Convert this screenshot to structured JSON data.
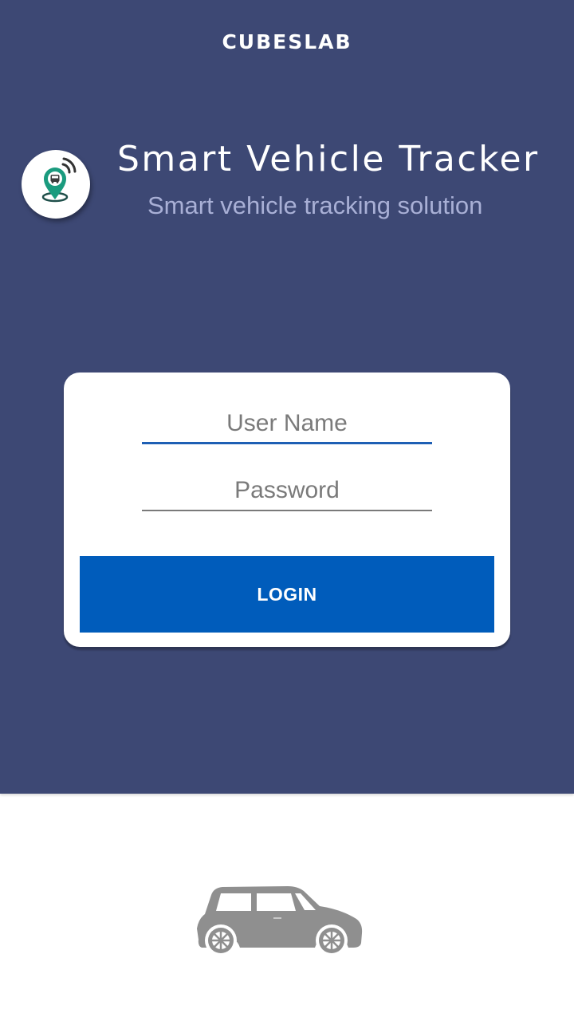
{
  "header": {
    "brand": "CUBESLAB",
    "app_title": "Smart Vehicle Tracker",
    "app_subtitle": "Smart vehicle tracking solution",
    "logo_icon": "location-pin-bus-icon",
    "background_color": "#3d4874"
  },
  "login_form": {
    "username_placeholder": "User Name",
    "username_value": "",
    "password_placeholder": "Password",
    "password_value": "",
    "login_label": "LOGIN",
    "button_color": "#005cbb"
  },
  "footer": {
    "illustration_icon": "car-icon"
  }
}
